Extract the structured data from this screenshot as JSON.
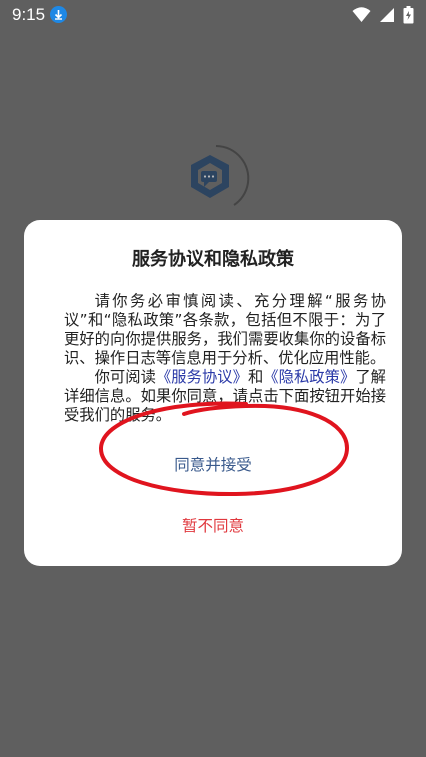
{
  "status_bar": {
    "time": "9:15",
    "icons": [
      "download-icon",
      "wifi-icon",
      "signal-icon",
      "battery-charging-icon"
    ]
  },
  "app_logo": {
    "icon": "chat-hexagon-logo",
    "color": "#2c4460"
  },
  "dialog": {
    "title": "服务协议和隐私政策",
    "body": {
      "p1": "请你务必审慎阅读、充分理解“服务协议”和“隐私政策”各条款，包括但不限于：为了更好的向你提供服务，我们需要收集你的设备标识、操作日志等信息用于分析、优化应用性能。",
      "p2_prefix": "你可阅读",
      "link_service": "《服务协议》",
      "p2_and": "和",
      "link_privacy": "《隐私政策》",
      "p2_suffix": "了解详细信息。如果你同意，请点击下面按钮开始接受我们的服务。"
    },
    "accept_label": "同意并接受",
    "reject_label": "暂不同意"
  },
  "colors": {
    "overlay": "#5f5f5f",
    "link": "#2b3aa8",
    "accept": "#3a5a8c",
    "reject": "#e0383e",
    "annotation": "#e0141e"
  }
}
